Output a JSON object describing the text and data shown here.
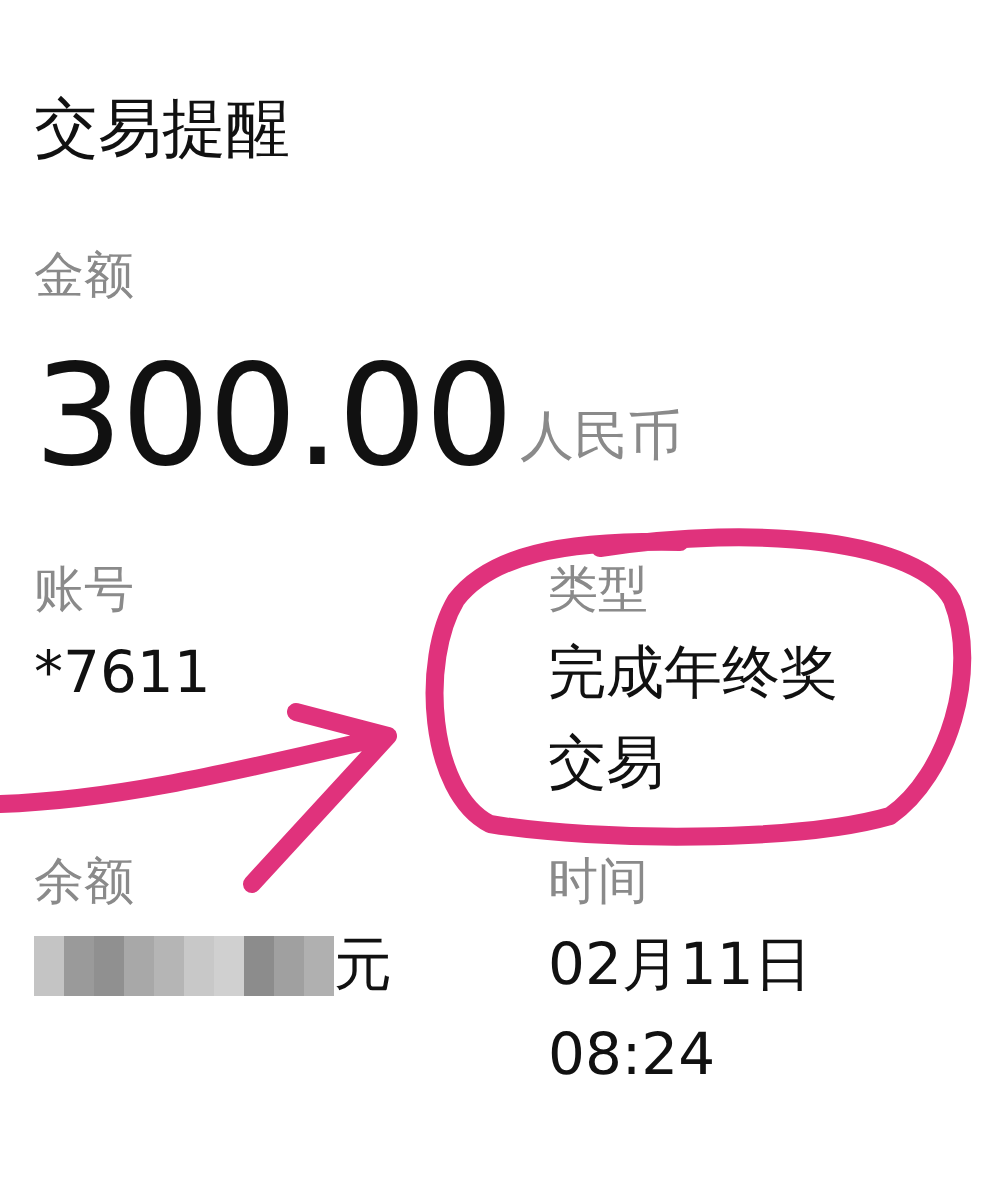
{
  "title": "交易提醒",
  "amount": {
    "label": "金额",
    "value": "300.00",
    "currency": "人民币"
  },
  "fields": [
    {
      "label": "账号",
      "lines": [
        "*7611"
      ],
      "masked": false
    },
    {
      "label": "类型",
      "lines": [
        "完成年终奖",
        "交易"
      ],
      "masked": false
    },
    {
      "label": "余额",
      "lines": [
        "元"
      ],
      "masked": true
    },
    {
      "label": "时间",
      "lines": [
        "02月11日",
        "08:24"
      ],
      "masked": false
    }
  ]
}
